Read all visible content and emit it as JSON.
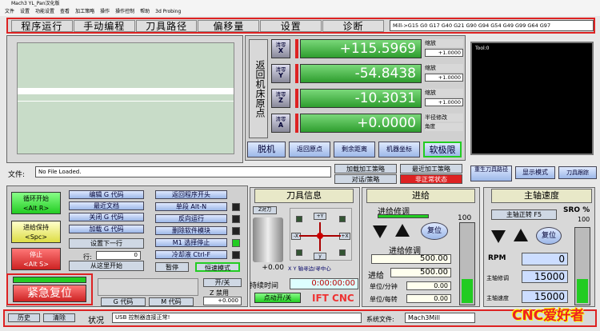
{
  "window": {
    "title": "Mach3 YL_Pan汉化版"
  },
  "menu": [
    "文件",
    "设置",
    "功能设置",
    "查看",
    "加工策略",
    "操作",
    "操作控制",
    "帮助",
    "3d Probing"
  ],
  "tabs": [
    "程序运行",
    "手动编程",
    "刀具路径",
    "偏移量",
    "设置",
    "诊断"
  ],
  "gcode_status": "Mill->G15  G0 G17 G40 G21 G90 G94 G54 G49 G99 G64 G97",
  "dro": {
    "return_home_label": "返回机床原点",
    "clear_label": "清零",
    "axes": [
      {
        "axis": "X",
        "value": "+115.5969",
        "scale_label": "缩放",
        "scale": "+1.0000"
      },
      {
        "axis": "Y",
        "value": "-54.8438",
        "scale_label": "缩放",
        "scale": "+1.0000"
      },
      {
        "axis": "Z",
        "value": "-10.3031",
        "scale_label": "缩放",
        "scale": "+1.0000"
      },
      {
        "axis": "A",
        "value": "+0.0000",
        "scale_label": "半径修改",
        "scale": "角度"
      }
    ],
    "buttons": [
      "脱机",
      "返回原点",
      "剩余距离",
      "机器坐标",
      "软极限"
    ]
  },
  "toolpath_label": "Tool:0",
  "file": {
    "label": "文件:",
    "value": "No File Loaded."
  },
  "mid_buttons": {
    "load_strategy": "加载加工策略",
    "recent_strategy": "最近加工策略",
    "dialog_strategy": "对话/策略",
    "abnormal": "非正常状态",
    "regen": "重生刀具路径",
    "display_mode": "显示模式",
    "jog_follow": "刀具跟踪"
  },
  "left": {
    "cycle_start": "循环开始",
    "cycle_start_key": "<Alt R>",
    "feed_hold": "进给保持",
    "feed_hold_key": "<Spc>",
    "stop": "停止",
    "stop_key": "<Alt S>",
    "emergency": "紧急复位",
    "edit_g": "编辑 G 代码",
    "recent_file": "最近文档",
    "close_g": "关闭 G 代码",
    "load_g": "加载 G 代码",
    "set_next": "设置下一行",
    "line_label": "行:",
    "line_value": "0",
    "run_from": "从这里开始",
    "return_start": "返回程序开头",
    "single_step": "单段 Alt-N",
    "reverse": "反向运行",
    "delete_block": "删除软件模块",
    "m1_stop": "M1 选择停止",
    "coolant": "冷却液 Ctrl-F",
    "pause": "暂停",
    "rapid": "恒速模式",
    "g_code": "G 代码",
    "m_code": "M 代码",
    "on_off": "开/关",
    "z_inhibit": "Z 禁用",
    "z_inhibit_val": "+0.000"
  },
  "tool": {
    "header": "刀具信息",
    "z_tool": "Z对刀",
    "dro_val": "+0.00",
    "xy_center": "X Y 轴寻边/寻中心",
    "jog": {
      "plus_y": "+Y",
      "minus_y": "-Y",
      "minus_x": "-X",
      "plus_x": "+X",
      "x": "x",
      "y": "y"
    },
    "run_time_label": "持续时间",
    "run_time": "0:00:00:00",
    "jog_label": "点动开/关",
    "brand": "IFT CNC"
  },
  "feed": {
    "header": "进给",
    "override_label": "进给修调",
    "override_val": "100",
    "reset": "复位",
    "feedrate_label": "进给修调",
    "feedrate": "500.00",
    "feed_label": "进给",
    "feed": "500.00",
    "units_min_label": "单位/分钟",
    "units_min": "0.00",
    "units_rev_label": "单位/每转",
    "units_rev": "0.00"
  },
  "spindle": {
    "header": "主轴速度",
    "cw": "主轴正转 F5",
    "sro_label": "SRO %",
    "sro": "100",
    "reset": "复位",
    "rpm_label": "RPM",
    "rpm": "0",
    "override_label": "主轴修调",
    "override": "15000",
    "speed_label": "主轴速度",
    "speed": "15000"
  },
  "status": {
    "history": "历史",
    "clear": "清除",
    "status_label": "状况",
    "status_value": "USB 控制器连接正常!",
    "profile_label": "系统文件:",
    "profile": "Mach3Mill"
  },
  "watermark": "CNC爱好者",
  "colors": {
    "accent_red": "#dd2222",
    "dro_green": "#2e9d2e"
  }
}
